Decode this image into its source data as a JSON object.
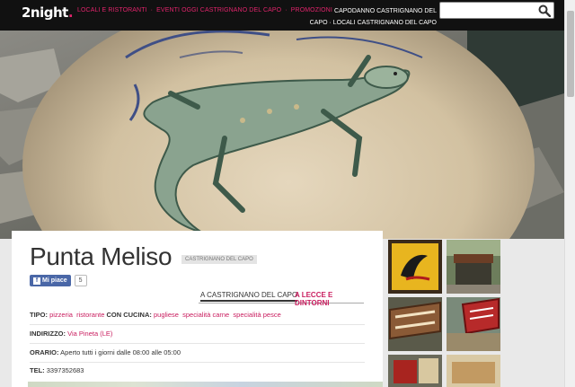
{
  "header": {
    "logo_text": "2night",
    "logo_dot": ".",
    "nav": [
      "LOCALI E RISTORANTI",
      "EVENTI OGGI CASTRIGNANO DEL CAPO",
      "PROMOZIONI"
    ],
    "nav_sep": "·",
    "hot_line1": "CAPODANNO CASTRIGNANO DEL",
    "hot_line2": "CAPO · LOCALI CASTRIGNANO DEL CAPO",
    "search_placeholder": ""
  },
  "venue": {
    "name": "Punta Meliso",
    "city_tag": "CASTRIGNANO DEL CAPO",
    "like_label": "Mi piace",
    "like_f": "f",
    "like_count": "5",
    "tab_local": "A CASTRIGNANO DEL CAPO",
    "tab_area": "A LECCE E DINTORNI",
    "tipo_label": "TIPO:",
    "tipo_values": [
      "pizzeria",
      "ristorante"
    ],
    "cucina_label": "CON CUCINA:",
    "cucina_values": [
      "pugliese",
      "specialità carne",
      "specialità pesce"
    ],
    "indirizzo_label": "INDIRIZZO:",
    "indirizzo_value": "Via Pineta (LE)",
    "orario_label": "ORARIO:",
    "orario_value": "Aperto tutti i giorni dalle 08:00 alle 05:00",
    "tel_label": "TEL:",
    "tel_value": "3397352683"
  },
  "colors": {
    "accent": "#c91c5e",
    "topbar": "#111111",
    "facebook": "#4a67a7"
  },
  "icons": {
    "search": "magnifier-icon"
  }
}
